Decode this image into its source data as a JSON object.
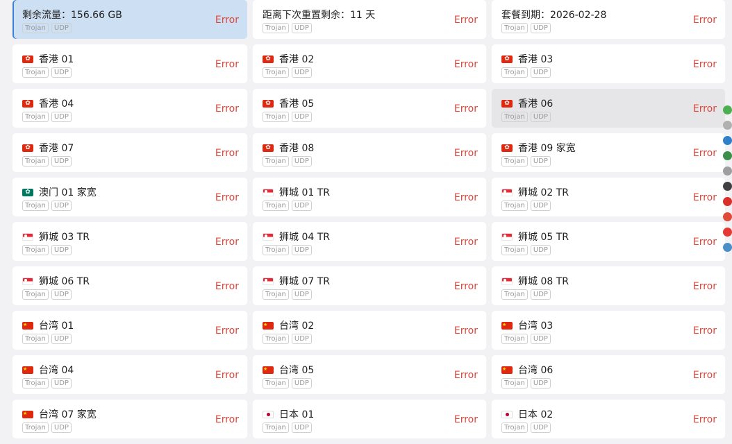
{
  "cards": [
    {
      "name": "剩余流量：156.66 GB",
      "flag": "",
      "tags": [
        "Trojan",
        "UDP"
      ],
      "status": "Error",
      "state": "selected"
    },
    {
      "name": "距离下次重置剩余：11 天",
      "flag": "",
      "tags": [
        "Trojan",
        "UDP"
      ],
      "status": "Error",
      "state": ""
    },
    {
      "name": "套餐到期：2026-02-28",
      "flag": "",
      "tags": [
        "Trojan",
        "UDP"
      ],
      "status": "Error",
      "state": ""
    },
    {
      "name": "香港 01",
      "flag": "hk",
      "tags": [
        "Trojan",
        "UDP"
      ],
      "status": "Error",
      "state": ""
    },
    {
      "name": "香港 02",
      "flag": "hk",
      "tags": [
        "Trojan",
        "UDP"
      ],
      "status": "Error",
      "state": ""
    },
    {
      "name": "香港 03",
      "flag": "hk",
      "tags": [
        "Trojan",
        "UDP"
      ],
      "status": "Error",
      "state": ""
    },
    {
      "name": "香港 04",
      "flag": "hk",
      "tags": [
        "Trojan",
        "UDP"
      ],
      "status": "Error",
      "state": ""
    },
    {
      "name": "香港 05",
      "flag": "hk",
      "tags": [
        "Trojan",
        "UDP"
      ],
      "status": "Error",
      "state": ""
    },
    {
      "name": "香港 06",
      "flag": "hk",
      "tags": [
        "Trojan",
        "UDP"
      ],
      "status": "Error",
      "state": "hover"
    },
    {
      "name": "香港 07",
      "flag": "hk",
      "tags": [
        "Trojan",
        "UDP"
      ],
      "status": "Error",
      "state": ""
    },
    {
      "name": "香港 08",
      "flag": "hk",
      "tags": [
        "Trojan",
        "UDP"
      ],
      "status": "Error",
      "state": ""
    },
    {
      "name": "香港 09 家宽",
      "flag": "hk",
      "tags": [
        "Trojan",
        "UDP"
      ],
      "status": "Error",
      "state": ""
    },
    {
      "name": "澳门 01 家宽",
      "flag": "mo",
      "tags": [
        "Trojan",
        "UDP"
      ],
      "status": "Error",
      "state": ""
    },
    {
      "name": "狮城 01 TR",
      "flag": "sg",
      "tags": [
        "Trojan",
        "UDP"
      ],
      "status": "Error",
      "state": ""
    },
    {
      "name": "狮城 02 TR",
      "flag": "sg",
      "tags": [
        "Trojan",
        "UDP"
      ],
      "status": "Error",
      "state": ""
    },
    {
      "name": "狮城 03 TR",
      "flag": "sg",
      "tags": [
        "Trojan",
        "UDP"
      ],
      "status": "Error",
      "state": ""
    },
    {
      "name": "狮城 04 TR",
      "flag": "sg",
      "tags": [
        "Trojan",
        "UDP"
      ],
      "status": "Error",
      "state": ""
    },
    {
      "name": "狮城 05 TR",
      "flag": "sg",
      "tags": [
        "Trojan",
        "UDP"
      ],
      "status": "Error",
      "state": ""
    },
    {
      "name": "狮城 06 TR",
      "flag": "sg",
      "tags": [
        "Trojan",
        "UDP"
      ],
      "status": "Error",
      "state": ""
    },
    {
      "name": "狮城 07 TR",
      "flag": "sg",
      "tags": [
        "Trojan",
        "UDP"
      ],
      "status": "Error",
      "state": ""
    },
    {
      "name": "狮城 08 TR",
      "flag": "sg",
      "tags": [
        "Trojan",
        "UDP"
      ],
      "status": "Error",
      "state": ""
    },
    {
      "name": "台湾 01",
      "flag": "cn",
      "tags": [
        "Trojan",
        "UDP"
      ],
      "status": "Error",
      "state": ""
    },
    {
      "name": "台湾 02",
      "flag": "cn",
      "tags": [
        "Trojan",
        "UDP"
      ],
      "status": "Error",
      "state": ""
    },
    {
      "name": "台湾 03",
      "flag": "cn",
      "tags": [
        "Trojan",
        "UDP"
      ],
      "status": "Error",
      "state": ""
    },
    {
      "name": "台湾 04",
      "flag": "cn",
      "tags": [
        "Trojan",
        "UDP"
      ],
      "status": "Error",
      "state": ""
    },
    {
      "name": "台湾 05",
      "flag": "cn",
      "tags": [
        "Trojan",
        "UDP"
      ],
      "status": "Error",
      "state": ""
    },
    {
      "name": "台湾 06",
      "flag": "cn",
      "tags": [
        "Trojan",
        "UDP"
      ],
      "status": "Error",
      "state": ""
    },
    {
      "name": "台湾 07 家宽",
      "flag": "cn",
      "tags": [
        "Trojan",
        "UDP"
      ],
      "status": "Error",
      "state": ""
    },
    {
      "name": "日本 01",
      "flag": "jp",
      "tags": [
        "Trojan",
        "UDP"
      ],
      "status": "Error",
      "state": ""
    },
    {
      "name": "日本 02",
      "flag": "jp",
      "tags": [
        "Trojan",
        "UDP"
      ],
      "status": "Error",
      "state": ""
    }
  ],
  "colors": {
    "error": "#e0463a",
    "selected_bg": "#cddff3",
    "selected_accent": "#3b82d6",
    "hover_bg": "#e6e6e8",
    "page_bg": "#f2f2f4"
  },
  "side_icons": [
    {
      "icon": "green-shield-icon",
      "color": "#4caf50"
    },
    {
      "icon": "recycle-icon",
      "color": "#b0b0b0"
    },
    {
      "icon": "globe-icon",
      "color": "#2f80c8"
    },
    {
      "icon": "globe-icon",
      "color": "#3a8f4a"
    },
    {
      "icon": "circle-m-icon",
      "color": "#9e9e9e"
    },
    {
      "icon": "server-icon",
      "color": "#404040"
    },
    {
      "icon": "apple-icon",
      "color": "#d9302c"
    },
    {
      "icon": "target-icon",
      "color": "#e04a3a"
    },
    {
      "icon": "red-circle-icon",
      "color": "#e53935"
    },
    {
      "icon": "fish-icon",
      "color": "#4a90c8"
    }
  ]
}
